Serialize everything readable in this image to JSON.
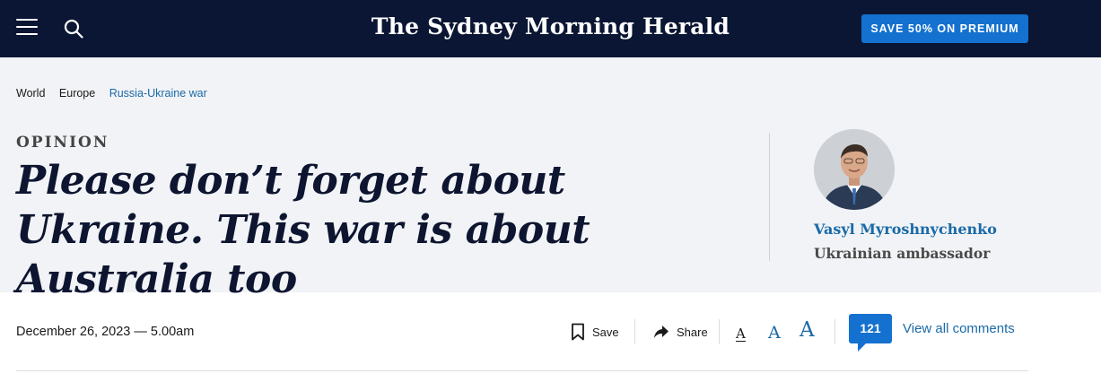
{
  "topbar": {
    "masthead": "The Sydney Morning Herald",
    "premium_label": "SAVE 50% ON PREMIUM",
    "icons": [
      "menu-icon",
      "search-icon"
    ],
    "colors": {
      "background": "#0a1633",
      "premium_button": "#1471cf"
    }
  },
  "breadcrumb": {
    "items": [
      {
        "label": "World"
      },
      {
        "label": "Europe"
      },
      {
        "label": "Russia-Ukraine war"
      }
    ]
  },
  "article": {
    "kicker": "OPINION",
    "headline": "Please don’t forget about Ukraine. This war is about Australia too",
    "dateline": "December 26, 2023 — 5.00am"
  },
  "author": {
    "name": "Vasyl Myroshnychenko",
    "role": "Ukrainian ambassador"
  },
  "tools": {
    "save_label": "Save",
    "share_label": "Share",
    "font_sizes": [
      "A",
      "A",
      "A"
    ],
    "comment_count": "121",
    "comments_label": "View all comments"
  },
  "colors": {
    "link": "#1a6aa8",
    "header_band": "#f1f3f6",
    "headline": "#0d1530"
  }
}
